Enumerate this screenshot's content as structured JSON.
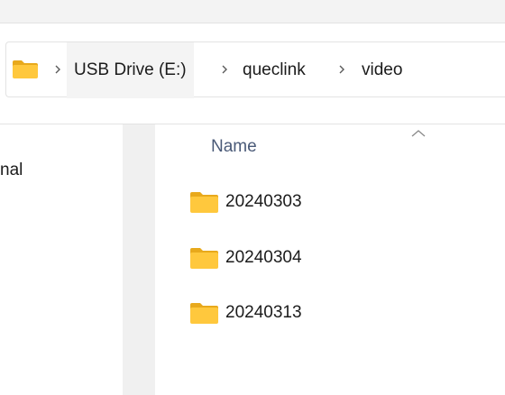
{
  "breadcrumb": {
    "items": [
      {
        "label": "USB Drive (E:)"
      },
      {
        "label": "queclink"
      },
      {
        "label": "video"
      }
    ]
  },
  "navigation": {
    "partial_item": "nal"
  },
  "file_list": {
    "column_header": "Name",
    "items": [
      {
        "name": "20240303",
        "icon": "folder-icon"
      },
      {
        "name": "20240304",
        "icon": "folder-icon"
      },
      {
        "name": "20240313",
        "icon": "folder-icon"
      }
    ]
  },
  "colors": {
    "folder_body": "#ffc83d",
    "folder_tab": "#e8a91c",
    "header_text": "#4a5a78"
  }
}
